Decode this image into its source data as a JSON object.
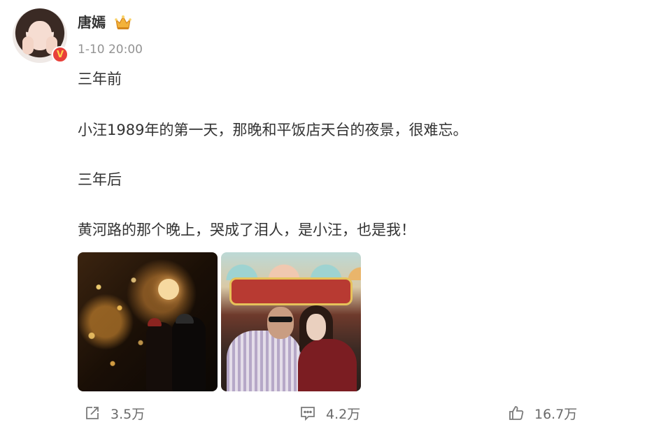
{
  "user": {
    "name": "唐嫣",
    "avatar_icon": "avatar",
    "verified_badge": "V",
    "crown_icon": "crown-icon"
  },
  "post": {
    "timestamp": "1-10 20:00",
    "paragraphs": [
      "三年前",
      "小汪1989年的第一天，那晚和平饭店天台的夜景，很难忘。",
      "三年后",
      "黄河路的那个晚上，哭成了泪人，是小汪，也是我！"
    ],
    "photos": [
      "photo-night-lights",
      "photo-neon-sign"
    ]
  },
  "actions": {
    "repost_count": "3.5万",
    "comment_count": "4.2万",
    "like_count": "16.7万"
  },
  "colors": {
    "text": "#333333",
    "muted": "#939393",
    "action": "#6a6a6a",
    "badge": "#e8403a"
  }
}
